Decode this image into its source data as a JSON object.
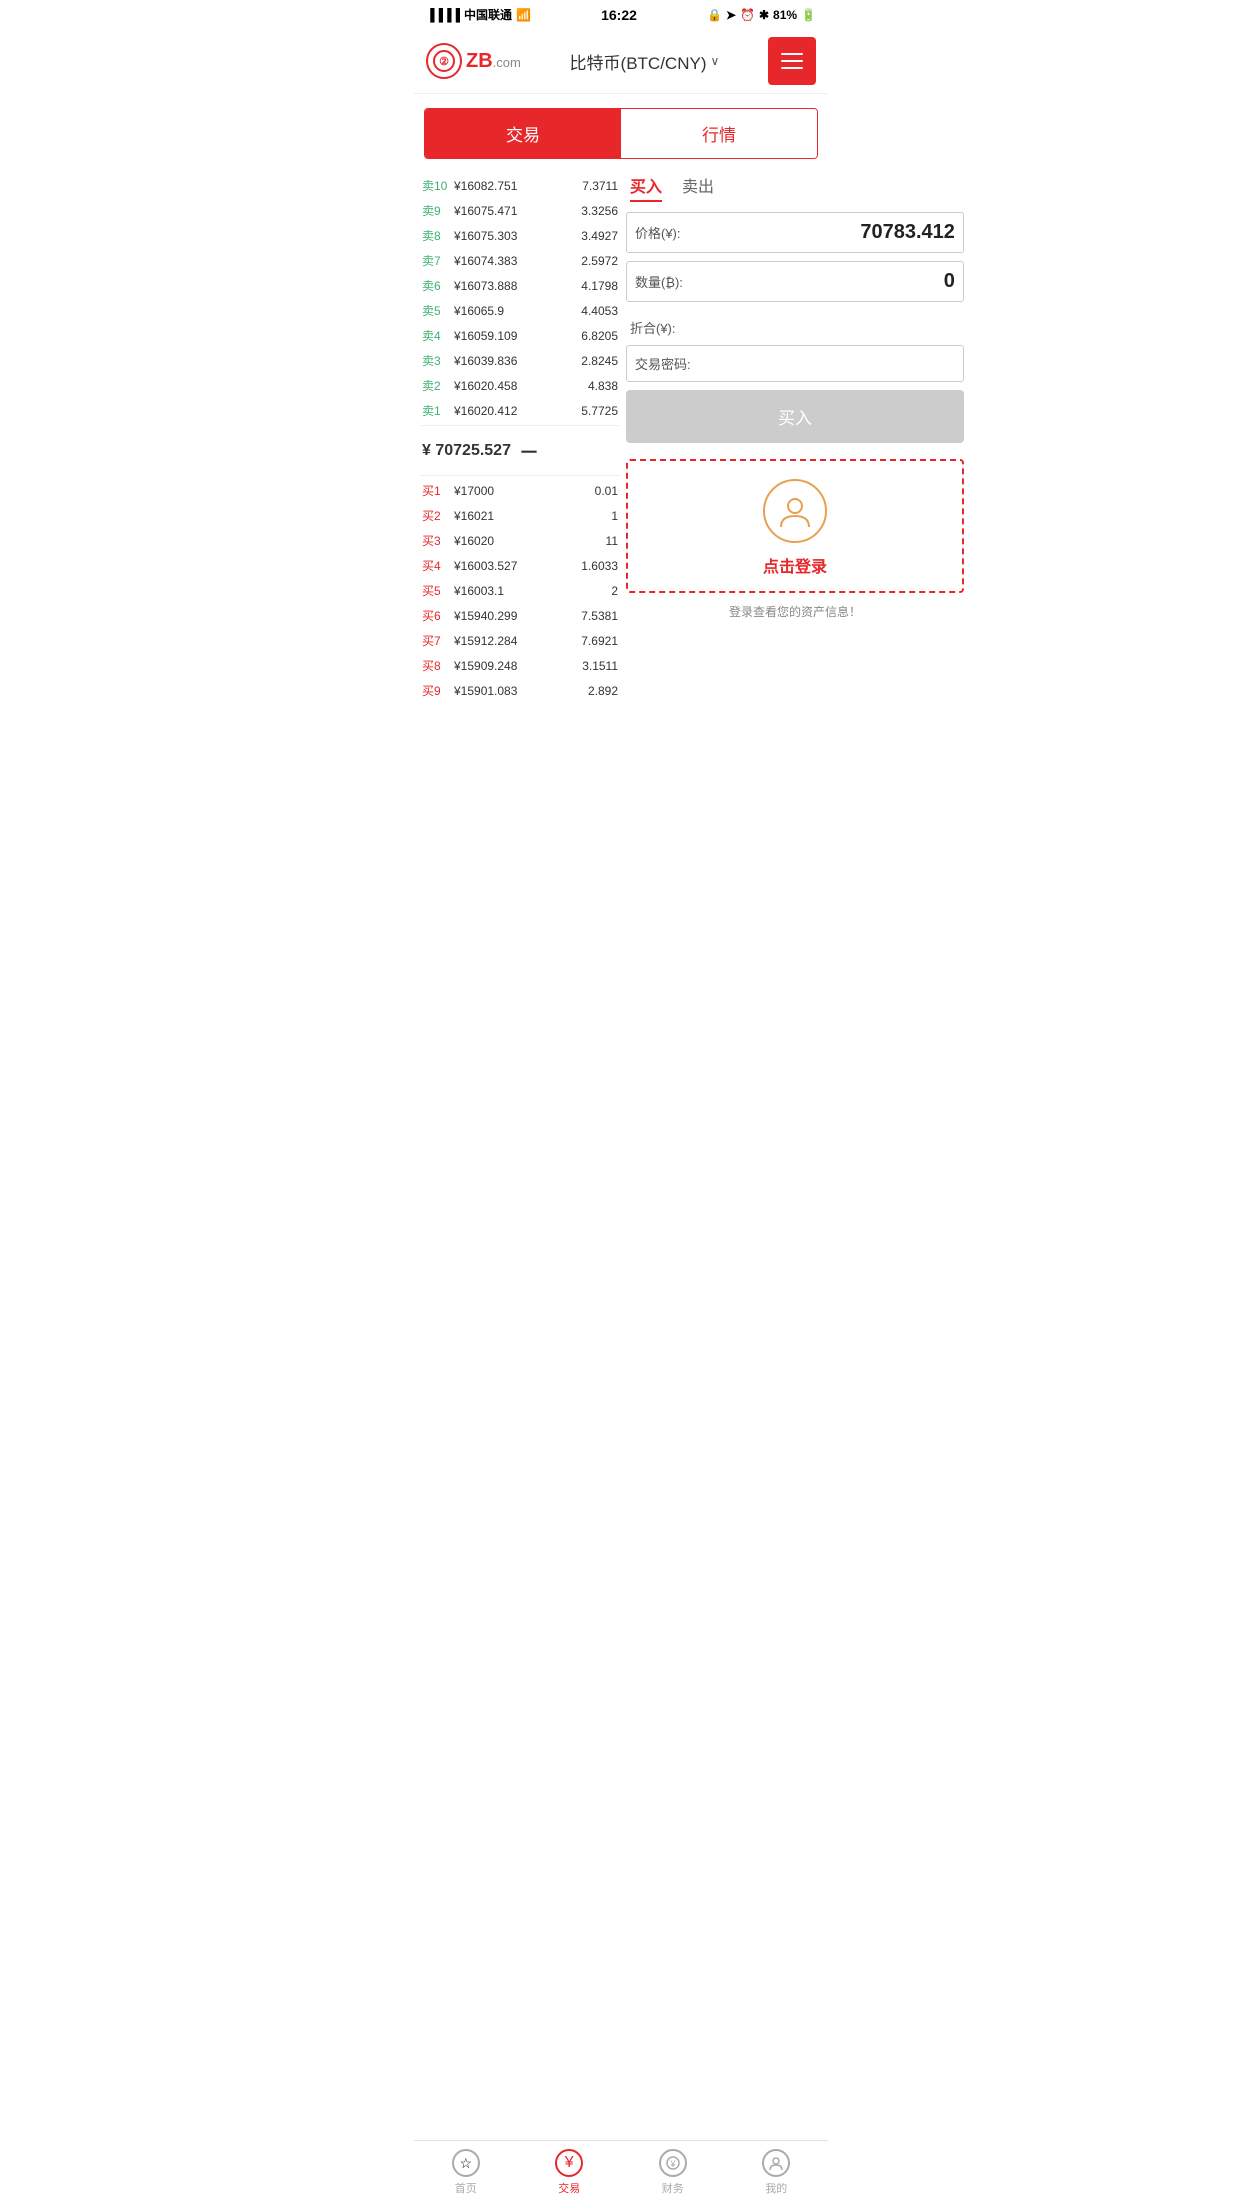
{
  "statusBar": {
    "carrier": "中国联通",
    "time": "16:22",
    "battery": "81%"
  },
  "header": {
    "logoText": "ZB",
    "logoDomain": ".com",
    "title": "比特币(BTC/CNY)",
    "menuLabel": "menu"
  },
  "tabs": {
    "active": "交易",
    "inactive": "行情"
  },
  "buySellTabs": {
    "buy": "买入",
    "sell": "卖出"
  },
  "sellOrders": [
    {
      "label": "卖10",
      "price": "¥16082.751",
      "qty": "7.3711"
    },
    {
      "label": "卖9",
      "price": "¥16075.471",
      "qty": "3.3256"
    },
    {
      "label": "卖8",
      "price": "¥16075.303",
      "qty": "3.4927"
    },
    {
      "label": "卖7",
      "price": "¥16074.383",
      "qty": "2.5972"
    },
    {
      "label": "卖6",
      "price": "¥16073.888",
      "qty": "4.1798"
    },
    {
      "label": "卖5",
      "price": "¥16065.9",
      "qty": "4.4053"
    },
    {
      "label": "卖4",
      "price": "¥16059.109",
      "qty": "6.8205"
    },
    {
      "label": "卖3",
      "price": "¥16039.836",
      "qty": "2.8245"
    },
    {
      "label": "卖2",
      "price": "¥16020.458",
      "qty": "4.838"
    },
    {
      "label": "卖1",
      "price": "¥16020.412",
      "qty": "5.7725"
    }
  ],
  "midPrice": {
    "price": "¥ 70725.527",
    "indicator": "－"
  },
  "buyOrders": [
    {
      "label": "买1",
      "price": "¥17000",
      "qty": "0.01"
    },
    {
      "label": "买2",
      "price": "¥16021",
      "qty": "1"
    },
    {
      "label": "买3",
      "price": "¥16020",
      "qty": "11"
    },
    {
      "label": "买4",
      "price": "¥16003.527",
      "qty": "1.6033"
    },
    {
      "label": "买5",
      "price": "¥16003.1",
      "qty": "2"
    },
    {
      "label": "买6",
      "price": "¥15940.299",
      "qty": "7.5381"
    },
    {
      "label": "买7",
      "price": "¥15912.284",
      "qty": "7.6921"
    },
    {
      "label": "买8",
      "price": "¥15909.248",
      "qty": "3.1511"
    },
    {
      "label": "买9",
      "price": "¥15901.083",
      "qty": "2.892"
    }
  ],
  "tradeForm": {
    "priceLabel": "价格(¥):",
    "priceValue": "70783.412",
    "qtyLabel": "数量(₿):",
    "qtyValue": "0",
    "foldLabel": "折合(¥):",
    "foldValue": "",
    "pwdLabel": "交易密码:",
    "pwdValue": "",
    "buyBtnLabel": "买入"
  },
  "loginBox": {
    "loginText": "点击登录",
    "hintText": "登录查看您的资产信息！"
  },
  "bottomNav": [
    {
      "label": "首页",
      "icon": "★",
      "active": false
    },
    {
      "label": "交易",
      "icon": "¥",
      "active": true
    },
    {
      "label": "财务",
      "icon": "💰",
      "active": false
    },
    {
      "label": "我的",
      "icon": "👤",
      "active": false
    }
  ]
}
